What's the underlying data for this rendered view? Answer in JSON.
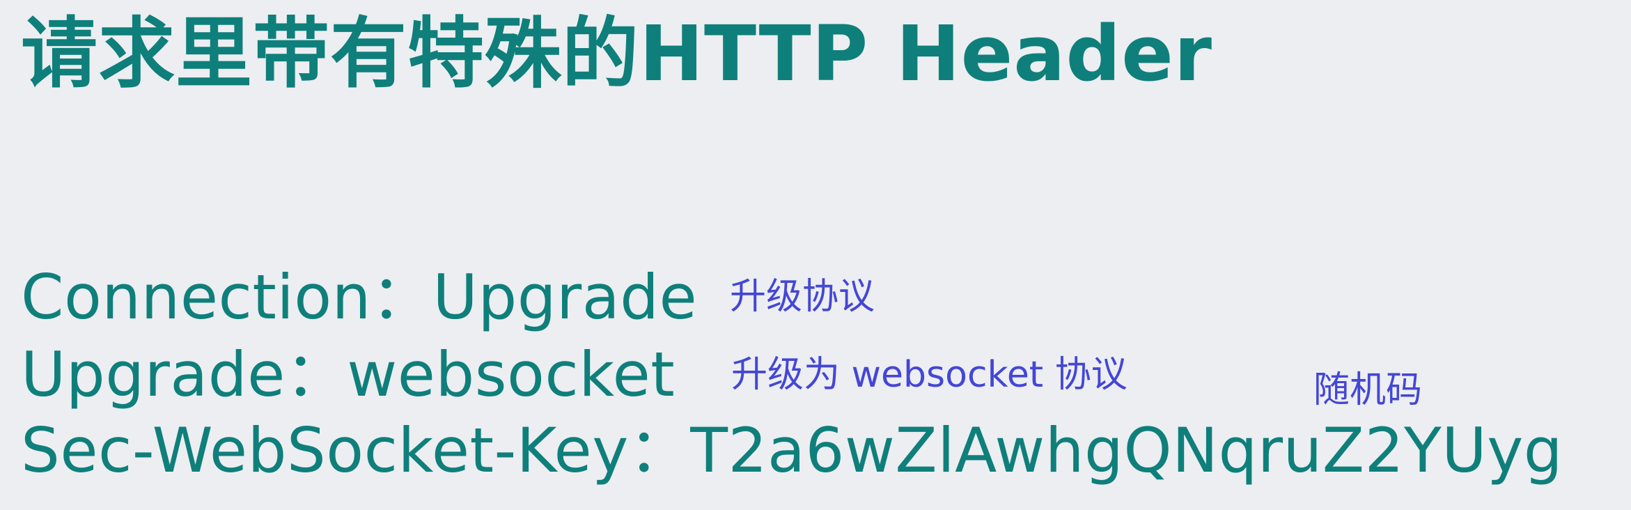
{
  "title": "请求里带有特殊的HTTP Header",
  "headers": [
    {
      "line": "Connection：Upgrade",
      "note": "升级协议"
    },
    {
      "line": "Upgrade：websocket",
      "note": "升级为 websocket 协议"
    },
    {
      "line": "Sec-WebSocket-Key：T2a6wZlAwhgQNqruZ2YUyg",
      "note": "随机码"
    }
  ],
  "colors": {
    "background": "#eceef1",
    "header_text": "#0f7f7b",
    "annotation_text": "#4446d6"
  }
}
